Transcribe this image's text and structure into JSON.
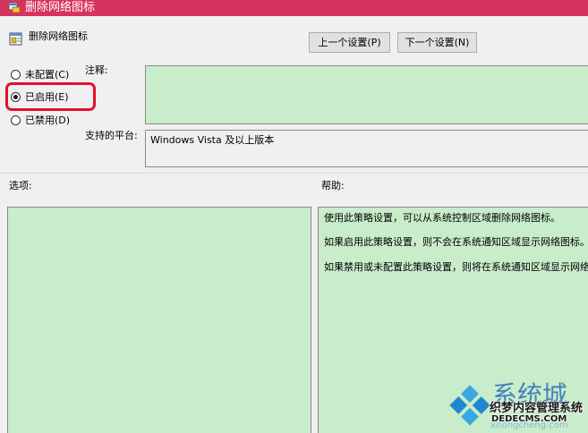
{
  "window": {
    "title": "删除网络图标",
    "title_bar_color": "#d6345f",
    "icon": "group-policy-setting-icon"
  },
  "header": {
    "setting_name": "删除网络图标",
    "icon": "policy-document-icon"
  },
  "navigation": {
    "prev_label": "上一个设置(P)",
    "next_label": "下一个设置(N)"
  },
  "state": {
    "options": [
      {
        "label": "未配置(C)",
        "selected": false
      },
      {
        "label": "已启用(E)",
        "selected": true
      },
      {
        "label": "已禁用(D)",
        "selected": false
      }
    ],
    "highlight_color": "#e0112d"
  },
  "comment": {
    "label": "注释:",
    "value": ""
  },
  "platform": {
    "label": "支持的平台:",
    "value": "Windows Vista 及以上版本"
  },
  "options_section": {
    "label": "选项:"
  },
  "help_section": {
    "label": "帮助:",
    "paragraphs": [
      "使用此策略设置，可以从系统控制区域删除网络图标。",
      "如果启用此策略设置，则不会在系统通知区域显示网络图标。",
      "如果禁用或未配置此策略设置，则将在系统通知区域显示网络图标。"
    ]
  },
  "colors": {
    "panel_fill": "#c9eccb",
    "window_bg": "#f0f0f0"
  },
  "watermark": {
    "chinese": "系统城",
    "pinyin": "xitongcheng.com",
    "site_name": "织梦内容管理系统",
    "site_domain": "DEDECMS.COM",
    "logo": "windows-logo-icon"
  }
}
